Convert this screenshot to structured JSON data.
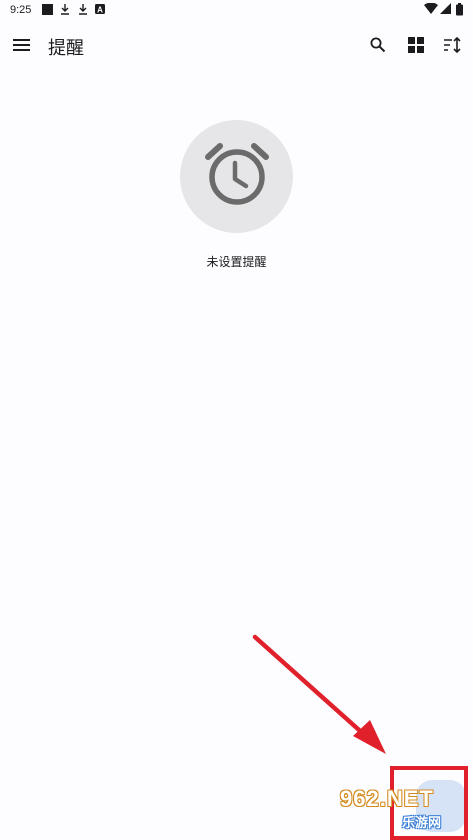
{
  "status_bar": {
    "time": "9:25",
    "icons": [
      "notification-square-icon",
      "download-icon",
      "download-icon",
      "a-badge-icon",
      "wifi-icon",
      "signal-icon",
      "battery-icon"
    ]
  },
  "app_bar": {
    "title": "提醒",
    "icons": [
      "menu-icon",
      "search-icon",
      "grid-view-icon",
      "sort-icon"
    ]
  },
  "empty_state": {
    "icon": "alarm-clock-icon",
    "message": "未设置提醒"
  },
  "fab": {
    "icon": "add-icon"
  },
  "watermark": {
    "top_text": "962.NET",
    "bottom_text": "乐游网"
  },
  "colors": {
    "background": "#fdfcff",
    "circle": "#e6e6e8",
    "icon_gray": "#6b6b6b",
    "fab": "#d6e3f7",
    "annotation_red": "#e0202a"
  }
}
